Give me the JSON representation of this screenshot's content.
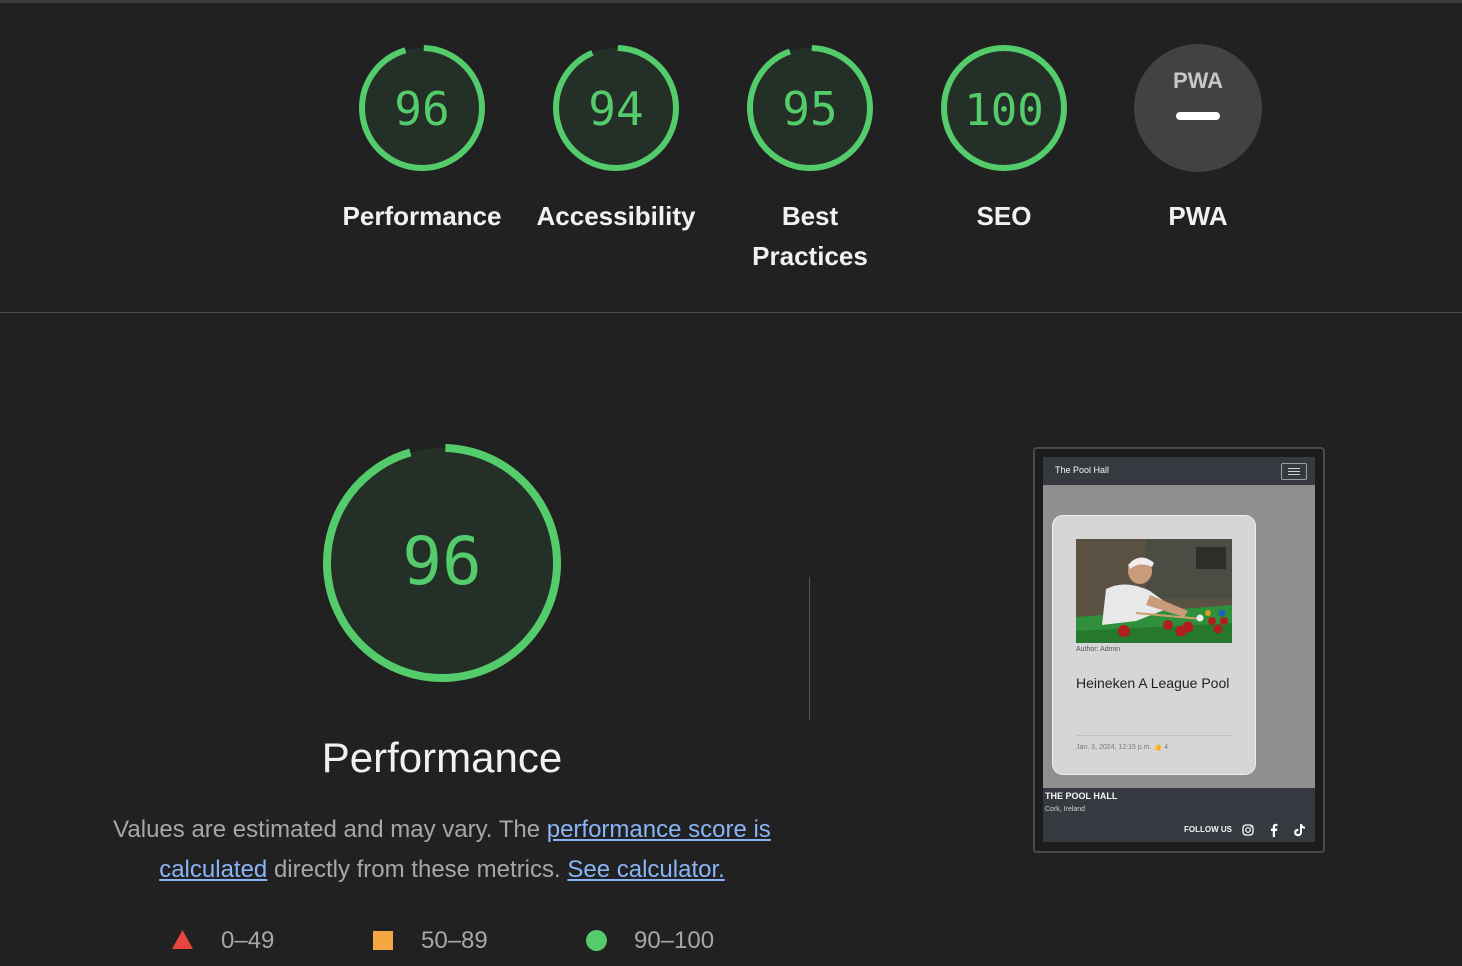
{
  "summary_gauges": [
    {
      "label": "Performance",
      "score": "96",
      "fraction": 0.96
    },
    {
      "label": "Accessibility",
      "score": "94",
      "fraction": 0.94
    },
    {
      "label": "Best Practices",
      "score": "95",
      "fraction": 0.95
    },
    {
      "label": "SEO",
      "score": "100",
      "fraction": 1.0
    },
    {
      "label": "PWA",
      "badge": "PWA",
      "status": "not-applicable"
    }
  ],
  "category": {
    "score": "96",
    "fraction": 0.96,
    "title": "Performance",
    "desc_prefix": "Values are estimated and may vary. The ",
    "link_score": "performance score is calculated",
    "desc_middle": " directly from these metrics. ",
    "link_calc": "See calculator."
  },
  "legend": [
    {
      "shape": "triangle",
      "range": "0–49",
      "color": "#e8453c"
    },
    {
      "shape": "square",
      "range": "50–89",
      "color": "#f4a742"
    },
    {
      "shape": "circle",
      "range": "90–100",
      "color": "#55cc6b"
    }
  ],
  "preview": {
    "brand": "The Pool Hall",
    "card_author": "Author: Admin",
    "card_title": "Heineken A League Pool",
    "card_meta": "Jan. 3, 2024, 12:15 p.m. 👍 4",
    "footer_title": "THE POOL HALL",
    "footer_location": "Cork, Ireland",
    "follow_label": "FOLLOW US",
    "social_icons": [
      "instagram-icon",
      "facebook-icon",
      "tiktok-icon"
    ]
  },
  "colors": {
    "pass": "#55cc6b",
    "pass_bg": "#243027",
    "neutral_bg": "#424242",
    "link": "#8ab4f8"
  }
}
